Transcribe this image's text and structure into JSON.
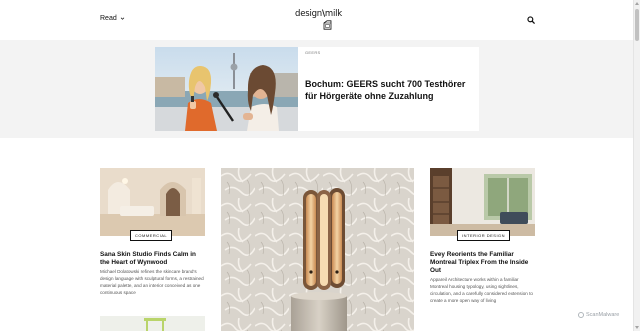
{
  "header": {
    "read_label": "Read",
    "logo_text_left": "design",
    "logo_separator": "\\",
    "logo_text_right": "milk",
    "icons": {
      "menu_chevron": "chevron-down-icon",
      "search": "search-icon",
      "logo_mark": "milk-carton-icon"
    }
  },
  "ad": {
    "brand": "GEERS",
    "title": "Bochum: GEERS sucht 700 Testhörer für Hörgeräte ohne Zuzahlung"
  },
  "articles": [
    {
      "tag": "COMMERCIAL",
      "title": "Sana Skin Studio Finds Calm in the Heart of Wynwood",
      "excerpt": "Michael Dolatowski refines the skincare brand's design language with sculptural forms, a restrained material palette, and an interior conceived as one continuous space"
    },
    {
      "tag": "INTERIOR DESIGN",
      "title": "Evey Reorients the Familiar Montreal Triplex From the Inside Out",
      "excerpt": "Appareil Architecture works within a familiar Montreal housing typology, using sightlines, circulation, and a carefully considered extension to create a more open way of living"
    }
  ],
  "watermark": "ScanMalware",
  "colors": {
    "ad_band": "#f3f3f3",
    "text": "#111111",
    "excerpt": "#555555"
  }
}
